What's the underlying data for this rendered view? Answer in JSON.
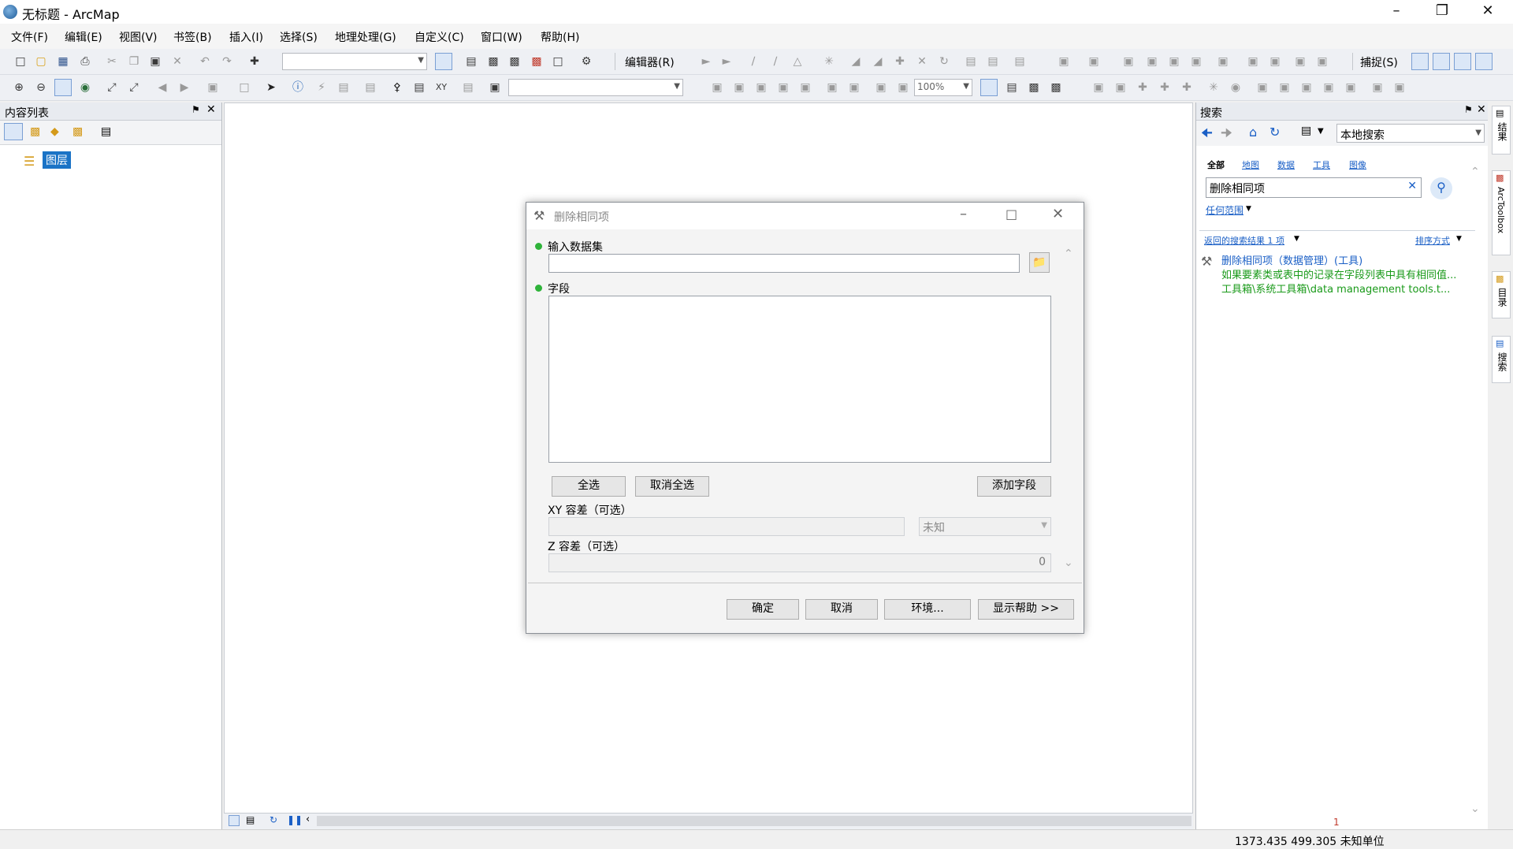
{
  "window": {
    "title": "无标题 - ArcMap"
  },
  "menu": [
    "文件(F)",
    "编辑(E)",
    "视图(V)",
    "书签(B)",
    "插入(I)",
    "选择(S)",
    "地理处理(G)",
    "自定义(C)",
    "窗口(W)",
    "帮助(H)"
  ],
  "toolbar": {
    "editor_label": "编辑器(R)",
    "snap_label": "捕捉(S)",
    "zoom_value": "100%"
  },
  "toc": {
    "title": "内容列表",
    "layers_label": "图层"
  },
  "dialog": {
    "title": "删除相同项",
    "input_label": "输入数据集",
    "fields_label": "字段",
    "select_all": "全选",
    "deselect_all": "取消全选",
    "add_field": "添加字段",
    "xy_label": "XY 容差（可选）",
    "unit_value": "未知",
    "z_label": "Z 容差（可选）",
    "z_value": "0",
    "ok": "确定",
    "cancel": "取消",
    "env": "环境...",
    "help": "显示帮助 >>"
  },
  "search": {
    "title": "搜索",
    "scope_value": "本地搜索",
    "tabs": [
      "全部",
      "地图",
      "数据",
      "工具",
      "图像"
    ],
    "query": "删除相同项",
    "extent": "任何范围",
    "results_summary": "返回的搜索结果 1 项",
    "sort": "排序方式",
    "result": {
      "title": "删除相同项（数据管理）(工具)",
      "desc": "如果要素类或表中的记录在字段列表中具有相同值...",
      "path": "工具箱\\系统工具箱\\data management tools.t..."
    },
    "page_number": "1"
  },
  "side_tabs": [
    "结果",
    "ArcToolbox",
    "目录",
    "搜索"
  ],
  "status": {
    "coords": "1373.435  499.305 未知单位"
  },
  "colors": {
    "accent": "#1a5fc6",
    "green": "#2fb33a",
    "path_green": "#1a9a1a"
  }
}
